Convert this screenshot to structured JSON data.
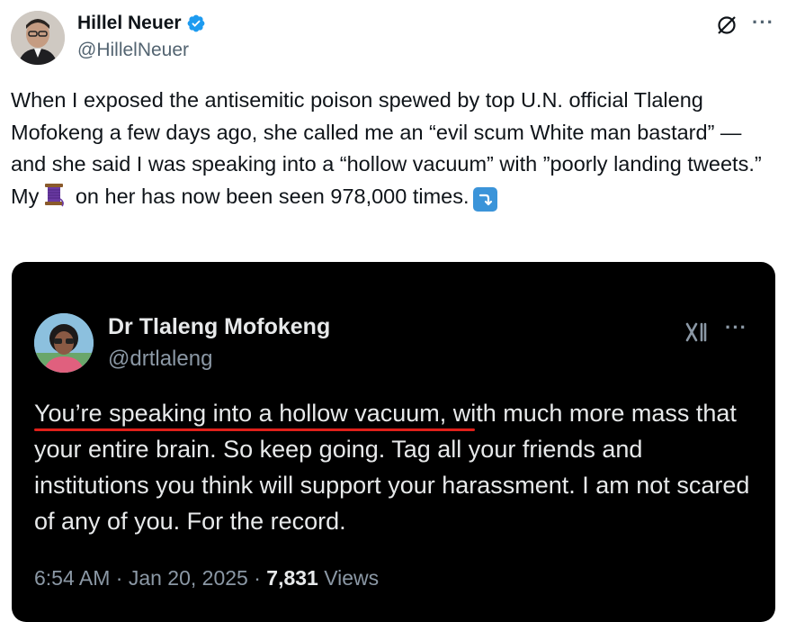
{
  "author": {
    "name": "Hillel Neuer",
    "handle": "@HillelNeuer",
    "verified": true,
    "verified_color": "#1d9bf0",
    "avatar_icon": "profile-photo"
  },
  "tweet": {
    "text_before_spool": "When I exposed the antisemitic poison spewed by top U.N. official Tlaleng Mofokeng a few days ago, she called me an “evil scum White man bastard” — and she said I was speaking into a “hollow vacuum” with ”poorly landing tweets.” My",
    "text_after_spool": " on her has now been seen 978,000 times.",
    "emoji_1": "thread-spool-icon",
    "emoji_2": "arrow-curving-down-icon"
  },
  "media_screenshot": {
    "author_name": "Dr Tlaleng Mofokeng",
    "author_handle": "@drtlaleng",
    "text": "You’re speaking into a hollow vacuum, with much more mass that your entire brain. So keep going. Tag all your friends and institutions you think will support your harassment. I am not scared of any of you. For the record.",
    "time": "6:54 AM · Jan 20, 2025 · ",
    "views_count": "7,831",
    "views_label": " Views",
    "underline_color": "#e0201a"
  }
}
